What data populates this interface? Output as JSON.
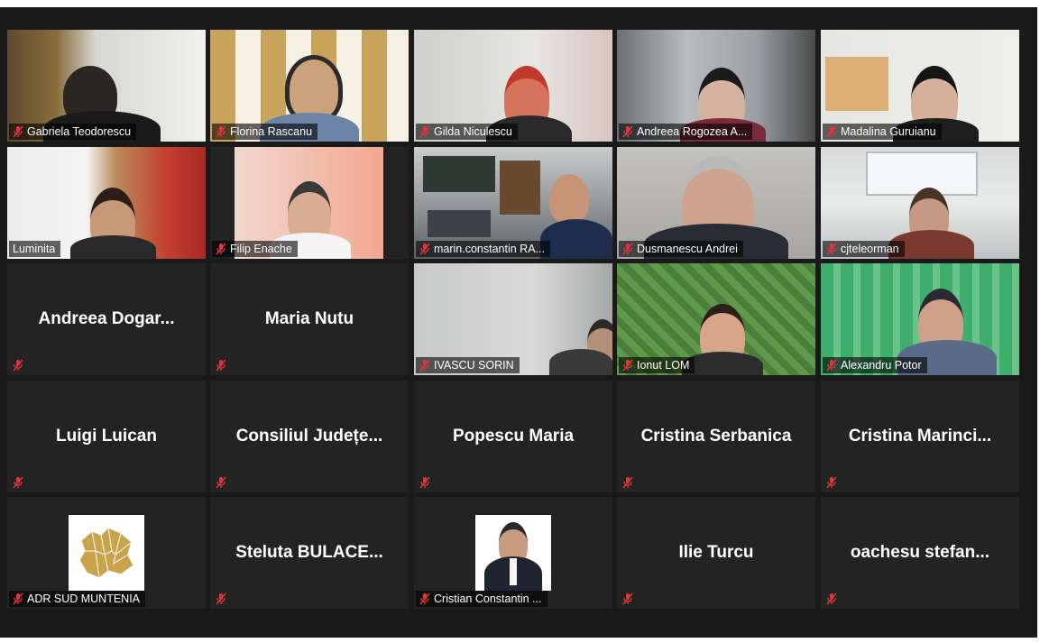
{
  "meeting": {
    "accent_active": "#e4e07a",
    "muted_color": "#e0353a"
  },
  "participants": [
    {
      "name": "Gabriela Teodorescu",
      "video": true
    },
    {
      "name": "Florina Rascanu",
      "video": true
    },
    {
      "name": "Gilda Niculescu",
      "video": true
    },
    {
      "name": "Andreea Rogozea A...",
      "video": true
    },
    {
      "name": "Madalina Guruianu",
      "video": true
    },
    {
      "name": "Luminita",
      "video": true,
      "active": true
    },
    {
      "name": "Filip Enache",
      "video": true
    },
    {
      "name": "marin.constantin RA...",
      "video": true
    },
    {
      "name": "Dusmanescu Andrei",
      "video": true
    },
    {
      "name": "cjteleorman",
      "video": true
    },
    {
      "name": "Andreea  Dogar...",
      "video": false
    },
    {
      "name": "Maria Nutu",
      "video": false
    },
    {
      "name": "IVASCU SORIN",
      "video": true
    },
    {
      "name": "Ionut LOM",
      "video": true
    },
    {
      "name": "Alexandru Potor",
      "video": true
    },
    {
      "name": "Luigi Luican",
      "video": false
    },
    {
      "name": "Consiliul  Județe...",
      "video": false
    },
    {
      "name": "Popescu Maria",
      "video": false
    },
    {
      "name": "Cristina Serbanica",
      "video": false
    },
    {
      "name": "Cristina  Marinci...",
      "video": false
    },
    {
      "name": "ADR SUD MUNTENIA",
      "video": false,
      "picture": "logo"
    },
    {
      "name": "Steluta  BULACE...",
      "video": false
    },
    {
      "name": "Cristian Constantin ...",
      "video": false,
      "picture": "photo"
    },
    {
      "name": "Ilie Turcu",
      "video": false
    },
    {
      "name": "oachesu  stefan...",
      "video": false
    }
  ],
  "icons": {
    "muted": "microphone-muted-icon"
  }
}
